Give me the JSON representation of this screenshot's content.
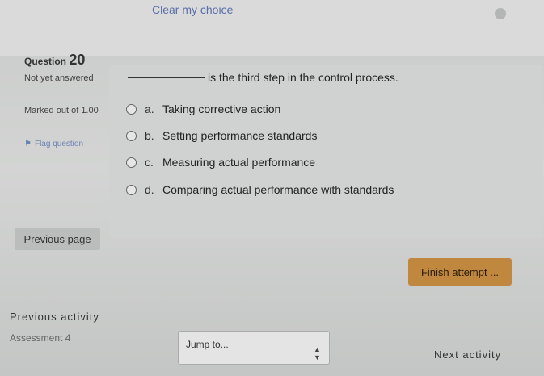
{
  "top": {
    "clear_choice": "Clear my choice"
  },
  "question": {
    "label": "Question",
    "number": "20",
    "status": "Not yet answered",
    "marked": "Marked out of 1.00",
    "flag": "Flag question",
    "text": "is the third step in the control process.",
    "options": [
      {
        "letter": "a.",
        "label": "Taking corrective action"
      },
      {
        "letter": "b.",
        "label": "Setting performance standards"
      },
      {
        "letter": "c.",
        "label": "Measuring actual performance"
      },
      {
        "letter": "d.",
        "label": "Comparing actual performance with standards"
      }
    ]
  },
  "nav": {
    "previous_page": "Previous page",
    "finish_attempt": "Finish attempt ...",
    "previous_activity": "Previous activity",
    "previous_activity_name": "Assessment 4",
    "jump_to": "Jump to...",
    "next_activity": "Next activity"
  }
}
